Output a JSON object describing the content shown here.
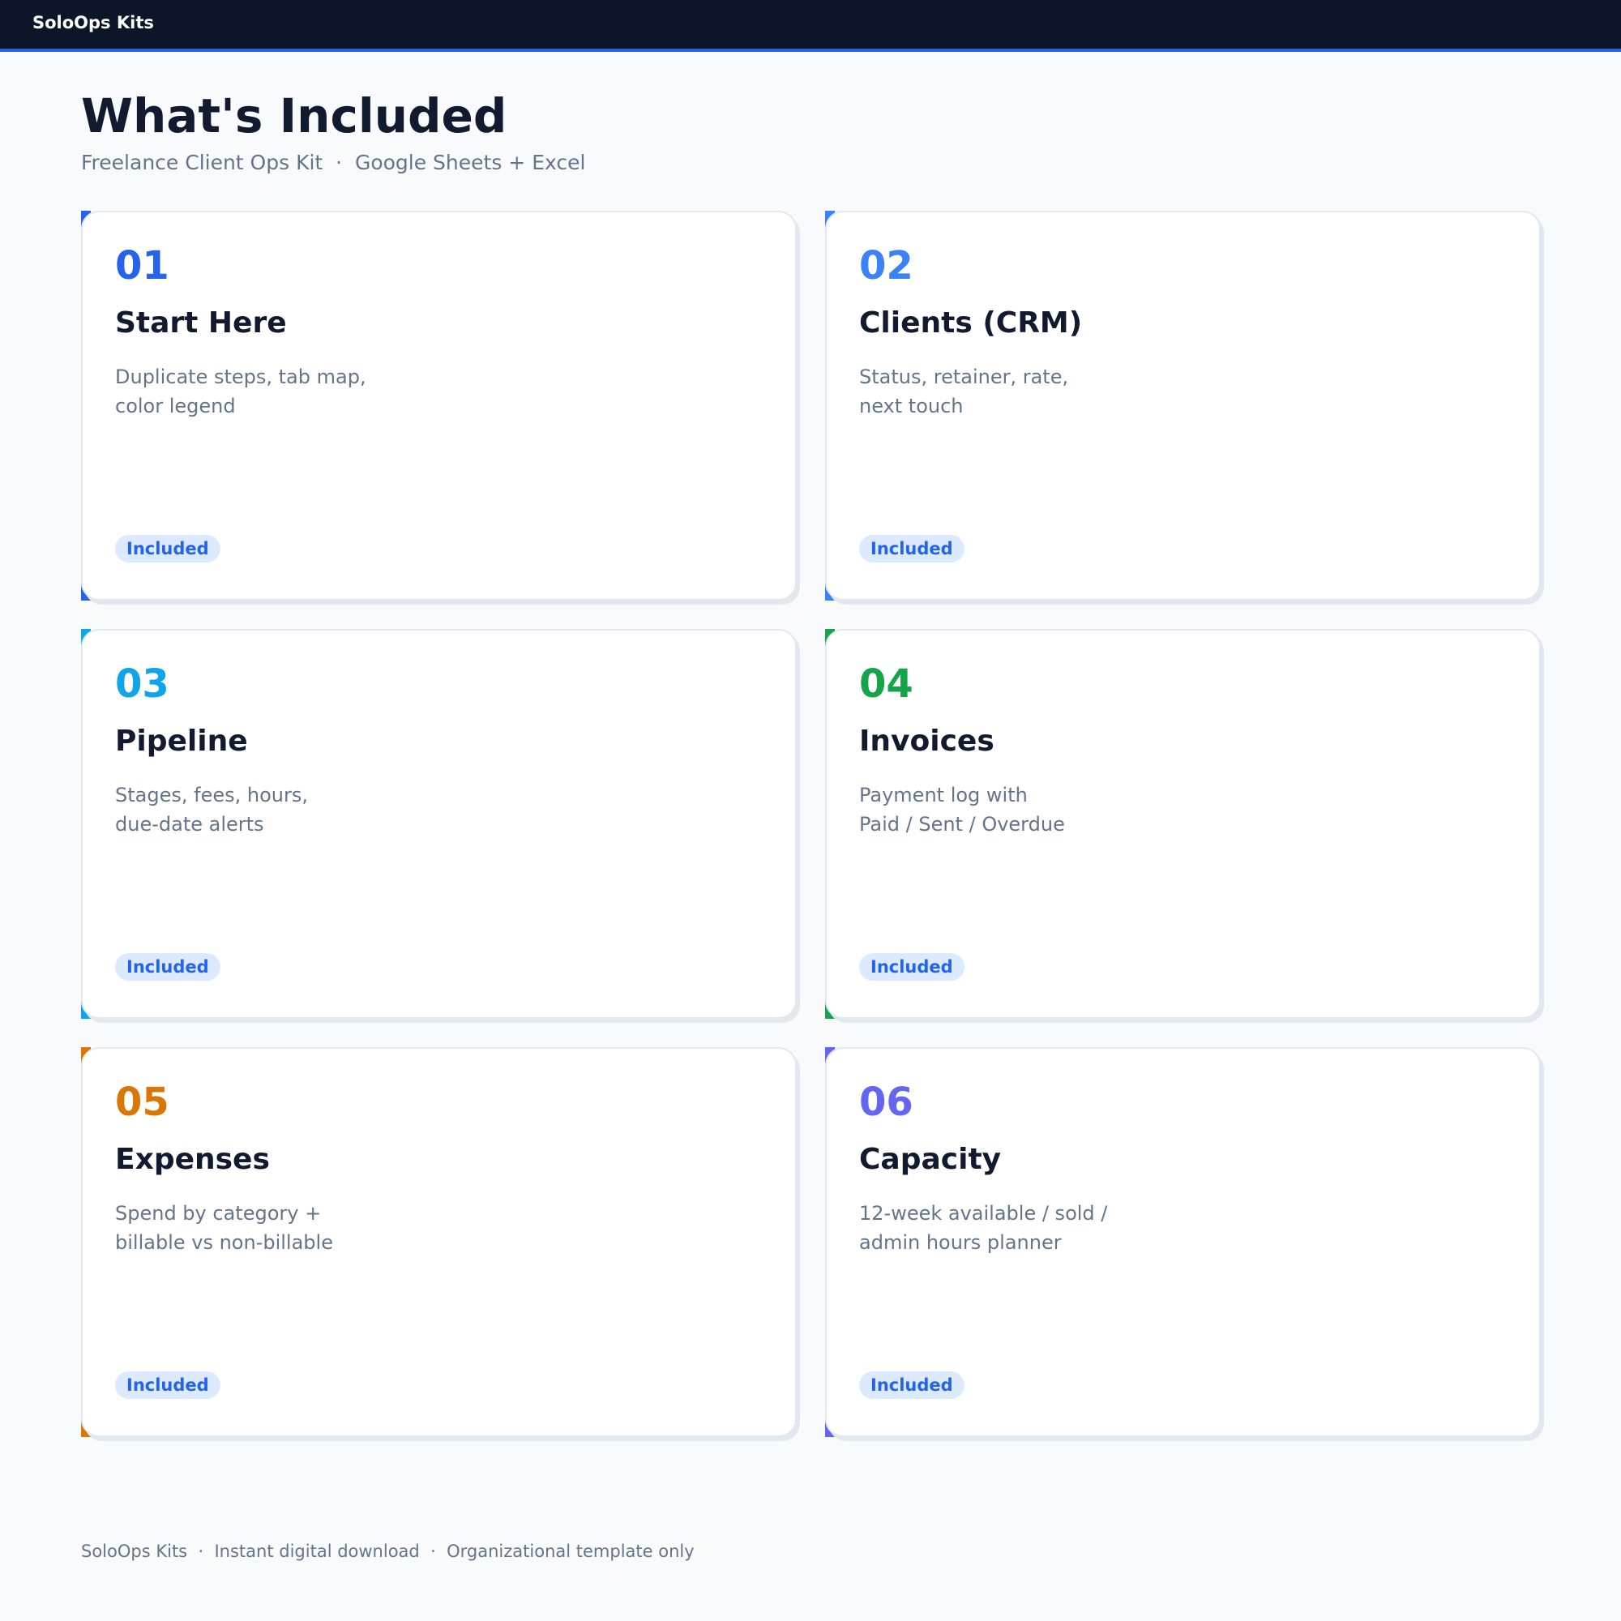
{
  "header": {
    "brand": "SoloOps Kits"
  },
  "page": {
    "title": "What's Included",
    "subtitle": "Freelance Client Ops Kit  ·  Google Sheets + Excel"
  },
  "cards": [
    {
      "number": "01",
      "title": "Start Here",
      "desc_line1": "Duplicate steps, tab map,",
      "desc_line2": "color legend",
      "badge": "Included",
      "accent": "#2563eb"
    },
    {
      "number": "02",
      "title": "Clients (CRM)",
      "desc_line1": "Status, retainer, rate,",
      "desc_line2": "next touch",
      "badge": "Included",
      "accent": "#3b82f6"
    },
    {
      "number": "03",
      "title": "Pipeline",
      "desc_line1": "Stages, fees, hours,",
      "desc_line2": "due-date alerts",
      "badge": "Included",
      "accent": "#0ea5e9"
    },
    {
      "number": "04",
      "title": "Invoices",
      "desc_line1": "Payment log with",
      "desc_line2": "Paid / Sent / Overdue",
      "badge": "Included",
      "accent": "#16a34a"
    },
    {
      "number": "05",
      "title": "Expenses",
      "desc_line1": "Spend by category +",
      "desc_line2": "billable vs non-billable",
      "badge": "Included",
      "accent": "#d97706"
    },
    {
      "number": "06",
      "title": "Capacity",
      "desc_line1": "12-week available / sold /",
      "desc_line2": "admin hours planner",
      "badge": "Included",
      "accent": "#6366f1"
    }
  ],
  "footer": {
    "text": "SoloOps Kits  ·  Instant digital download  ·  Organizational template only"
  }
}
